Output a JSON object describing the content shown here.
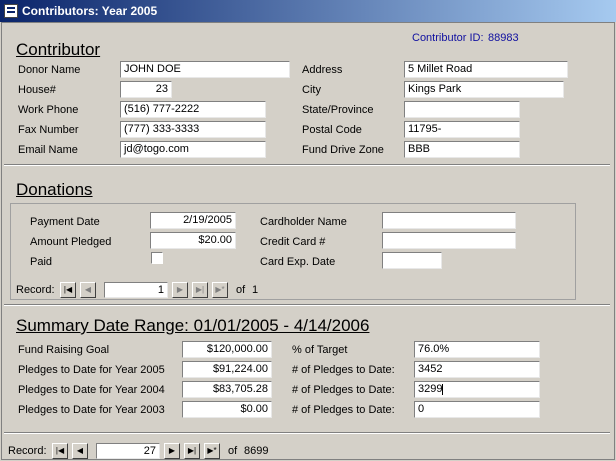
{
  "window": {
    "title": "Contributors: Year 2005"
  },
  "contributor": {
    "section_title": "Contributor",
    "id_label": "Contributor ID:",
    "id_value": "88983",
    "donor_name_label": "Donor Name",
    "donor_name": "JOHN DOE",
    "house_label": "House#",
    "house": "23",
    "work_phone_label": "Work Phone",
    "work_phone": "(516) 777-2222",
    "fax_label": "Fax Number",
    "fax": "(777) 333-3333",
    "email_label": "Email Name",
    "email": "jd@togo.com",
    "address_label": "Address",
    "address": "5 Millet Road",
    "city_label": "City",
    "city": "Kings Park",
    "state_label": "State/Province",
    "state": "",
    "postal_label": "Postal Code",
    "postal": "11795-",
    "zone_label": "Fund Drive Zone",
    "zone": "BBB"
  },
  "donations": {
    "section_title": "Donations",
    "payment_date_label": "Payment Date",
    "payment_date": "2/19/2005",
    "amount_label": "Amount Pledged",
    "amount": "$20.00",
    "paid_label": "Paid",
    "cardholder_label": "Cardholder Name",
    "cardholder": "",
    "card_number_label": "Credit Card #",
    "card_number": "",
    "card_exp_label": "Card Exp. Date",
    "card_exp": "",
    "nav": {
      "record_label": "Record:",
      "current": "1",
      "of_label": "of",
      "total": "1"
    }
  },
  "summary": {
    "section_title": "Summary Date Range: 01/01/2005 - 4/14/2006",
    "goal_label": "Fund Raising Goal",
    "goal": "$120,000.00",
    "p2005_label": "Pledges to Date for Year 2005",
    "p2005": "$91,224.00",
    "p2004_label": "Pledges to Date for Year 2004",
    "p2004": "$83,705.28",
    "p2003_label": "Pledges to Date for Year 2003",
    "p2003": "$0.00",
    "target_label": "% of Target",
    "target": "76.0%",
    "count1_label": "# of Pledges to Date:",
    "count1": "3452",
    "count2_label": "# of Pledges to Date:",
    "count2": "3299",
    "count3_label": "# of Pledges to Date:",
    "count3": "0"
  },
  "main_nav": {
    "record_label": "Record:",
    "current": "27",
    "of_label": "of",
    "total": "8699"
  },
  "icons": {
    "first": "first-record-icon",
    "prev": "previous-record-icon",
    "next": "next-record-icon",
    "last": "last-record-icon",
    "new": "new-record-icon"
  }
}
